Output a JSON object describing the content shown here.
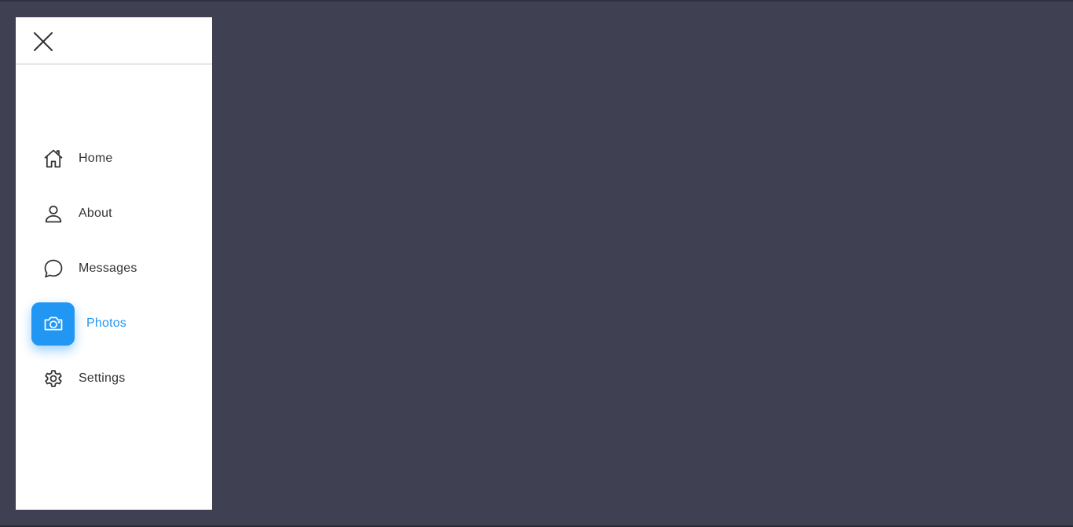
{
  "sidebar": {
    "close_icon": "close-icon",
    "items": [
      {
        "label": "Home",
        "icon": "home-icon",
        "active": false
      },
      {
        "label": "About",
        "icon": "user-icon",
        "active": false
      },
      {
        "label": "Messages",
        "icon": "chat-bubble-icon",
        "active": false
      },
      {
        "label": "Photos",
        "icon": "camera-icon",
        "active": true
      },
      {
        "label": "Settings",
        "icon": "gear-icon",
        "active": false
      }
    ]
  },
  "colors": {
    "background": "#3f4153",
    "sidebar": "#ffffff",
    "accent": "#2196f3",
    "text": "#333333"
  }
}
